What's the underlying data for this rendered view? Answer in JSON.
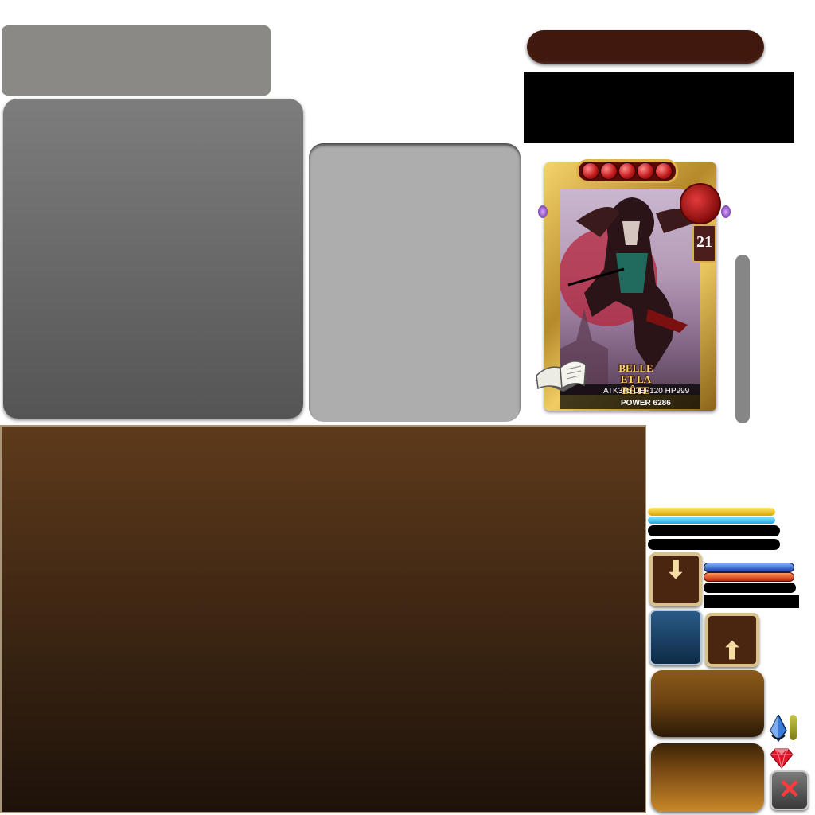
{
  "card": {
    "stars": 5,
    "level": "21",
    "series_logo": "BELLE ET LA BÊTE",
    "stats": "ATK345  DEF120  HP999",
    "power": "POWER 6286"
  },
  "close_button": {
    "glyph": "✕"
  },
  "colors": {
    "panel_brown": "#5e3a1b",
    "title_pill": "#41180e",
    "gold_frame": "#e0b44b",
    "bar_gold": "#f5c400",
    "bar_cyan": "#3bbdf0",
    "bar_blue": "#2a4fd0",
    "bar_red": "#e2451a"
  },
  "icons": [
    "book-icon",
    "rose-seal-icon",
    "crystal-icon",
    "ruby-icon",
    "arrow-down-icon",
    "arrow-up-icon",
    "close-icon"
  ]
}
